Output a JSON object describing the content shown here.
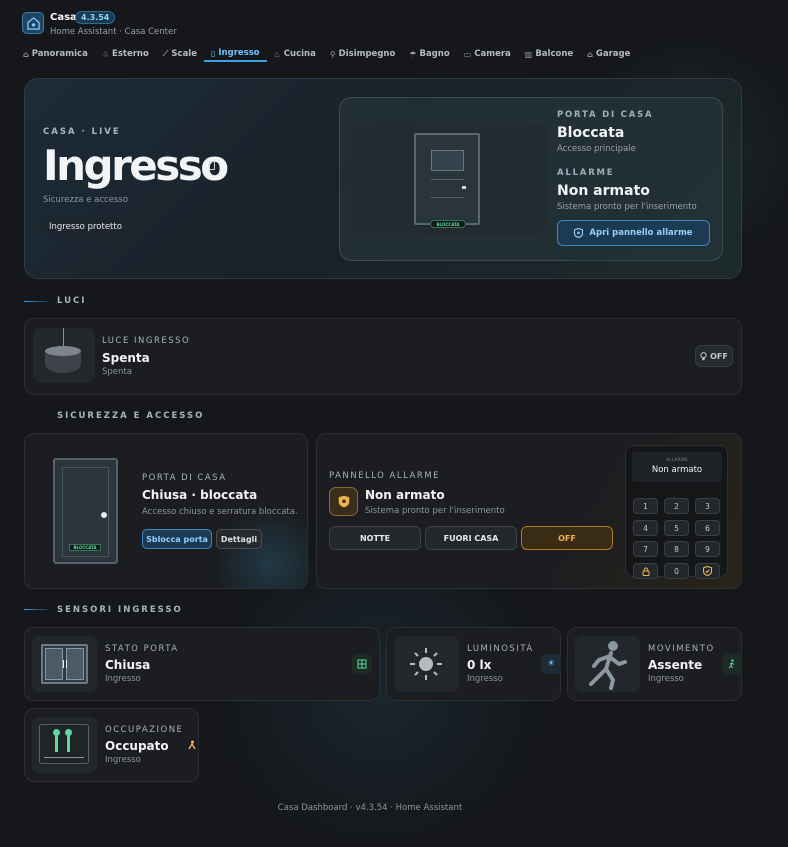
{
  "app": {
    "title": "Casa",
    "version": "4.3.54",
    "subtitle": "Home Assistant · Casa Center"
  },
  "tabs": [
    {
      "label": "Panoramica",
      "icon": "home-icon"
    },
    {
      "label": "Esterno",
      "icon": "tree-icon"
    },
    {
      "label": "Scale",
      "icon": "stairs-icon"
    },
    {
      "label": "Ingresso",
      "icon": "door-icon",
      "active": true
    },
    {
      "label": "Cucina",
      "icon": "pot-icon"
    },
    {
      "label": "Disimpegno",
      "icon": "walk-icon"
    },
    {
      "label": "Bagno",
      "icon": "shower-icon"
    },
    {
      "label": "Camera",
      "icon": "bed-icon"
    },
    {
      "label": "Balcone",
      "icon": "balcony-icon"
    },
    {
      "label": "Garage",
      "icon": "garage-icon"
    }
  ],
  "hero": {
    "kicker": "CASA · LIVE",
    "title": "Ingresso",
    "subtitle": "Sicurezza e accesso",
    "chip": "Ingresso protetto",
    "door_badge": "BLOCCATA",
    "door_kicker": "PORTA DI CASA",
    "door_state": "Bloccata",
    "door_sub": "Accesso principale",
    "alarm_kicker": "ALLARME",
    "alarm_state": "Non armato",
    "alarm_sub": "Sistema pronto per l'inserimento",
    "alarm_button": "Apri pannello allarme"
  },
  "sections": {
    "lights": "LUCI",
    "security": "SICUREZZA E ACCESSO",
    "sensors": "SENSORI INGRESSO"
  },
  "light": {
    "kicker": "LUCE INGRESSO",
    "state": "Spenta",
    "sub": "Spenta",
    "toggle": "OFF"
  },
  "door": {
    "kicker": "PORTA DI CASA",
    "state": "Chiusa · bloccata",
    "sub": "Accesso chiuso e serratura bloccata.",
    "badge": "BLOCCATA",
    "unlock": "Sblocca porta",
    "details": "Dettagli"
  },
  "alarm": {
    "kicker": "PANNELLO ALLARME",
    "state": "Non armato",
    "sub": "Sistema pronto per l'inserimento",
    "modes": [
      "NOTTE",
      "FUORI CASA",
      "OFF"
    ],
    "active_mode": "OFF",
    "keypad_label": "ALLARME",
    "keypad_value": "Non armato",
    "keys": [
      "1",
      "2",
      "3",
      "4",
      "5",
      "6",
      "7",
      "8",
      "9",
      "0"
    ]
  },
  "sensors": [
    {
      "kicker": "STATO PORTA",
      "state": "Chiusa",
      "sub": "Ingresso",
      "icon": "door-closed-icon"
    },
    {
      "kicker": "LUMINOSITÀ",
      "state": "0 lx",
      "sub": "Ingresso",
      "icon": "sun-icon"
    },
    {
      "kicker": "MOVIMENTO",
      "state": "Assente",
      "sub": "Ingresso",
      "icon": "motion-icon"
    },
    {
      "kicker": "OCCUPAZIONE",
      "state": "Occupato",
      "sub": "Ingresso",
      "icon": "occupancy-icon"
    }
  ],
  "footer": "Casa Dashboard · v4.3.54 · Home Assistant",
  "colors": {
    "accent": "#3aa0e8",
    "warning": "#f0b252",
    "success": "#5fd89a"
  }
}
